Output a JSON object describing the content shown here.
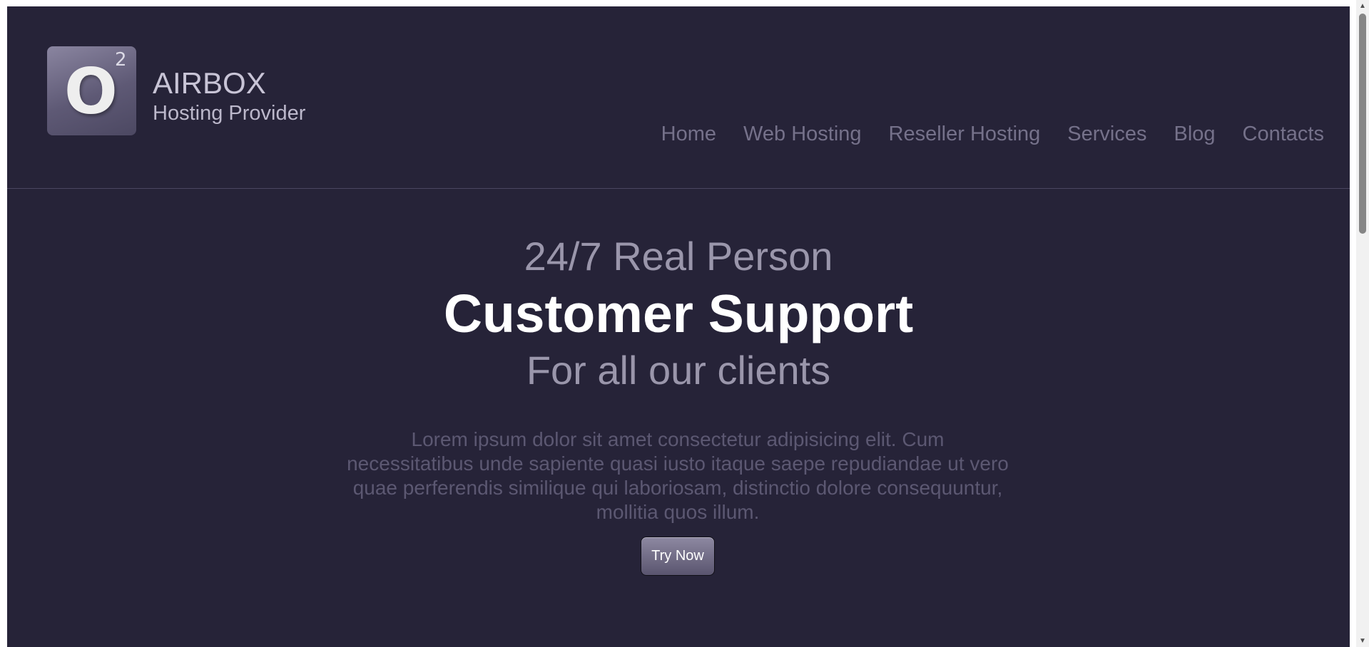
{
  "header": {
    "logo_letter": "O",
    "logo_superscript": "2",
    "brand_name": "AIRBOX",
    "brand_tagline": "Hosting Provider",
    "nav": [
      "Home",
      "Web Hosting",
      "Reseller Hosting",
      "Services",
      "Blog",
      "Contacts"
    ]
  },
  "hero": {
    "line1": "24/7 Real Person",
    "line2": "Customer Support",
    "line3": "For all our clients",
    "text": "Lorem ipsum dolor sit amet consectetur adipisicing elit. Cum necessitatibus unde sapiente quasi iusto itaque saepe repudiandae ut vero quae perferendis similique qui laboriosam, distinctio dolore consequuntur, mollitia quos illum.",
    "button_label": "Try Now"
  },
  "colors": {
    "background": "#262338",
    "nav_text": "#75718a",
    "heading_muted": "#9a96ab",
    "heading_strong": "#ffffff"
  },
  "icons": {
    "scroll_up": "triangle-up",
    "scroll_down": "triangle-down"
  }
}
